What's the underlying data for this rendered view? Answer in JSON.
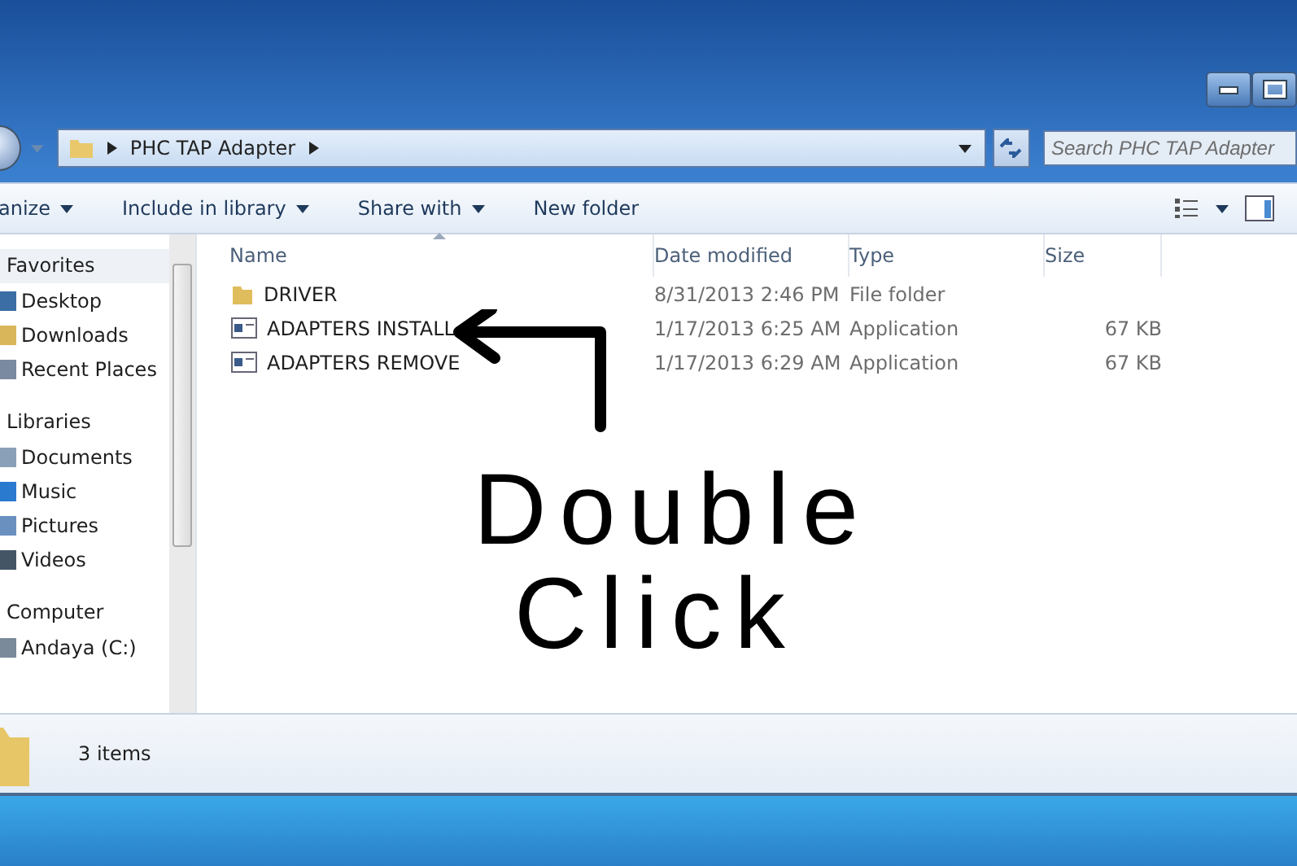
{
  "address": {
    "path": "PHC TAP Adapter"
  },
  "search": {
    "placeholder": "Search PHC TAP Adapter"
  },
  "toolbar": [
    {
      "label": "anize",
      "dropdown": true
    },
    {
      "label": "Include in library",
      "dropdown": true
    },
    {
      "label": "Share with",
      "dropdown": true
    },
    {
      "label": "New folder",
      "dropdown": false
    }
  ],
  "sidebar": {
    "groups": [
      {
        "label": "Favorites",
        "items": [
          {
            "label": "Desktop",
            "kind": "desktop"
          },
          {
            "label": "Downloads",
            "kind": "downloads"
          },
          {
            "label": "Recent Places",
            "kind": "recent"
          }
        ]
      },
      {
        "label": "Libraries",
        "items": [
          {
            "label": "Documents",
            "kind": "documents"
          },
          {
            "label": "Music",
            "kind": "music"
          },
          {
            "label": "Pictures",
            "kind": "pictures"
          },
          {
            "label": "Videos",
            "kind": "videos"
          }
        ]
      },
      {
        "label": "Computer",
        "items": [
          {
            "label": "Andaya (C:)",
            "kind": "drive"
          }
        ]
      }
    ]
  },
  "table": {
    "columns": [
      {
        "label": "Name",
        "sorted": true
      },
      {
        "label": "Date modified",
        "sorted": false
      },
      {
        "label": "Type",
        "sorted": false
      },
      {
        "label": "Size",
        "sorted": false
      }
    ],
    "rows": [
      {
        "kind": "folder",
        "name": "DRIVER",
        "date": "8/31/2013 2:46 PM",
        "type": "File folder",
        "size": ""
      },
      {
        "kind": "application",
        "name": "ADAPTERS INSTALL",
        "date": "1/17/2013 6:25 AM",
        "type": "Application",
        "size": "67 KB"
      },
      {
        "kind": "application",
        "name": "ADAPTERS REMOVE",
        "date": "1/17/2013 6:29 AM",
        "type": "Application",
        "size": "67 KB"
      }
    ]
  },
  "annotation": {
    "lines": [
      "Double",
      "Click"
    ]
  },
  "status_bar": {
    "text": "3 items"
  }
}
